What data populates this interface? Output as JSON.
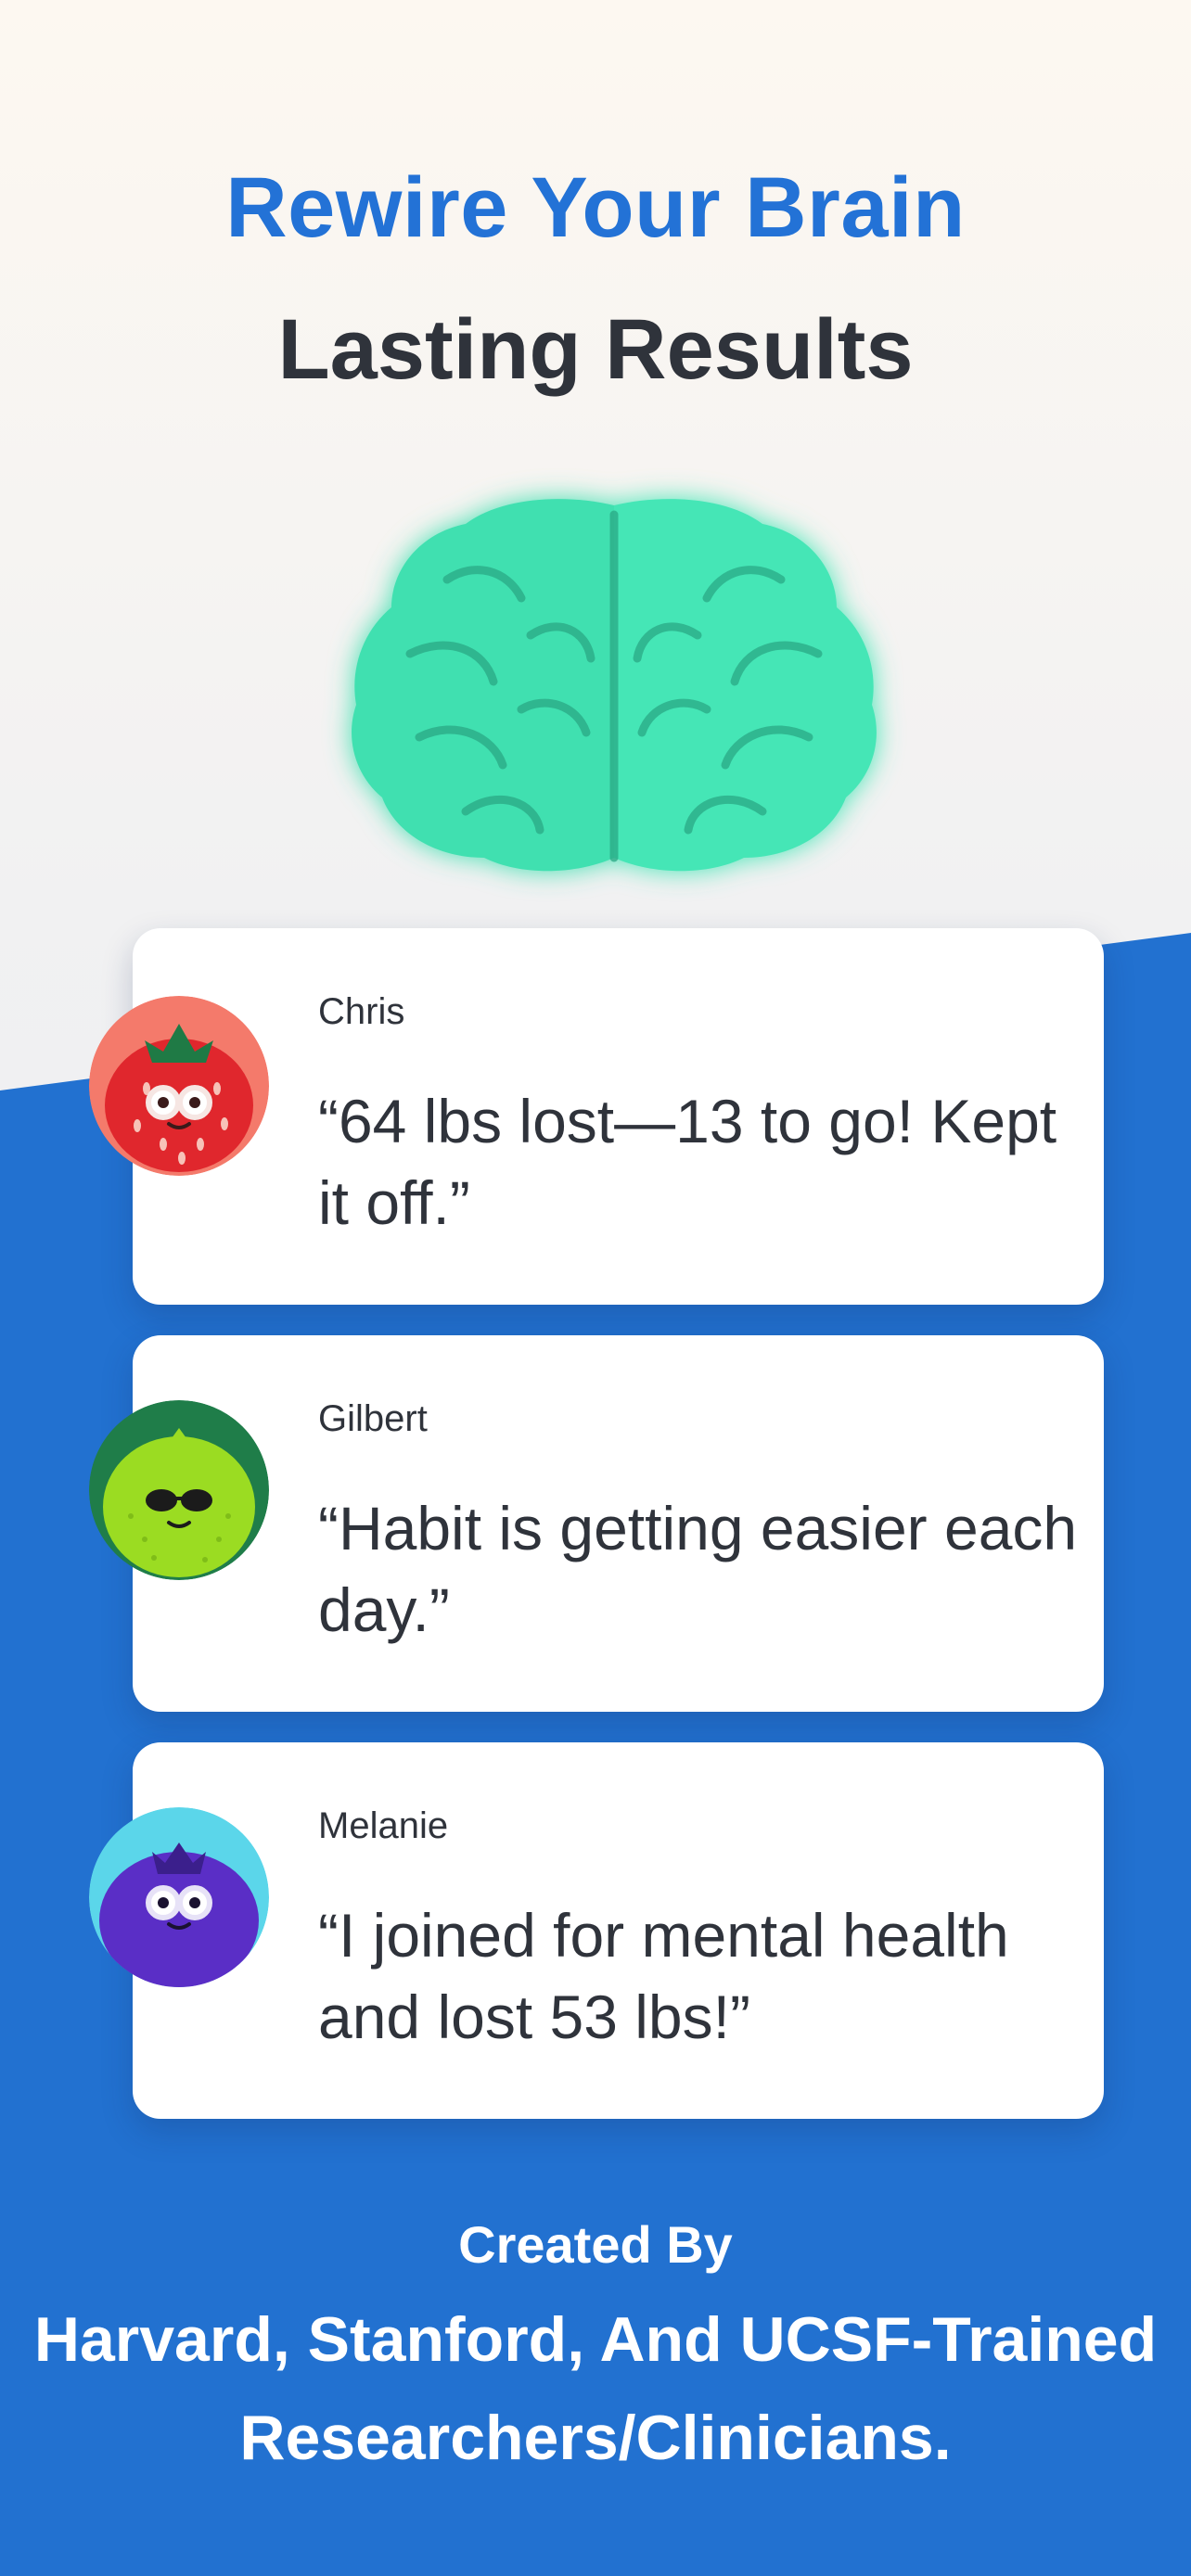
{
  "header": {
    "title": "Rewire Your Brain",
    "subtitle": "Lasting Results"
  },
  "brain": {
    "icon": "brain-icon",
    "color": "#3fe0b0"
  },
  "testimonials": [
    {
      "name": "Chris",
      "quote": "“64 lbs lost—13 to go! Kept it off.”",
      "avatar": "strawberry-avatar-icon"
    },
    {
      "name": "Gilbert",
      "quote": "“Habit is getting easier each day.”",
      "avatar": "lime-avatar-icon"
    },
    {
      "name": "Melanie",
      "quote": "“I joined for mental health and lost 53 lbs!”",
      "avatar": "blueberry-avatar-icon"
    }
  ],
  "footer": {
    "created_by": "Created By",
    "credits": "Harvard, Stanford, And UCSF-Trained Researchers/Clinicians."
  },
  "colors": {
    "accent_blue": "#2372d6",
    "background_blue": "#2271d0",
    "text_dark": "#2f333b"
  }
}
